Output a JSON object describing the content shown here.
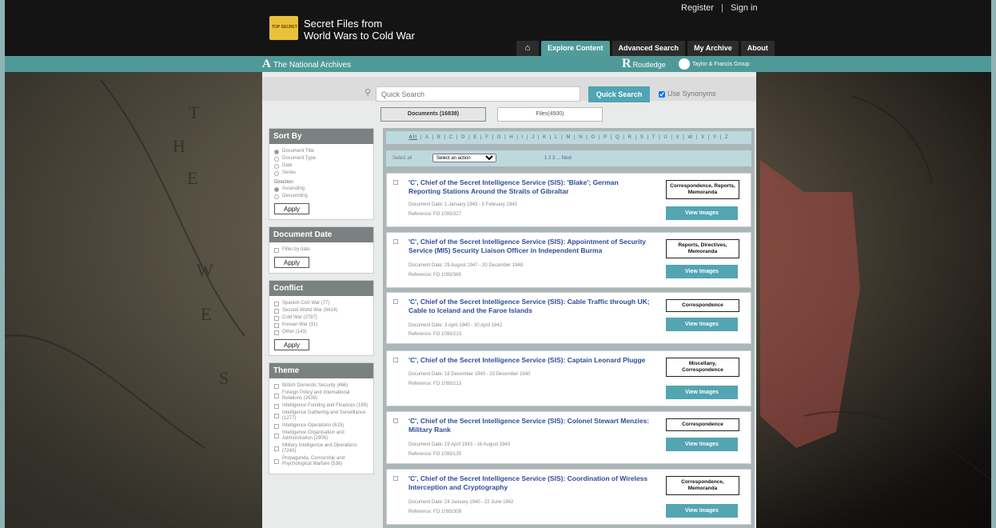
{
  "header": {
    "logo_text": "TOP SECRET",
    "site_title_line1": "Secret Files from",
    "site_title_line2": "World Wars to Cold War",
    "register": "Register",
    "separator": "|",
    "signin": "Sign in",
    "nav": [
      {
        "label": "⌂"
      },
      {
        "label": "Explore Content"
      },
      {
        "label": "Advanced Search"
      },
      {
        "label": "My Archive"
      },
      {
        "label": "About"
      }
    ],
    "tna_logo": "A",
    "tna_label": "The National Archives",
    "routledge_logo": "R",
    "routledge_label": "Routledge",
    "tf_label": "Taylor & Francis Group"
  },
  "search": {
    "placeholder": "Quick Search",
    "button": "Quick Search",
    "synonyms": "Use Synonyms"
  },
  "tabs": {
    "documents": "Documents (16838)",
    "files": "Files(4500)"
  },
  "sidebar": {
    "sort_by": {
      "title": "Sort By",
      "options": [
        "Document Title",
        "Document Type",
        "Date",
        "Series"
      ],
      "direction_label": "Direction",
      "direction": [
        "Ascending",
        "Descending"
      ],
      "apply": "Apply"
    },
    "document_date": {
      "title": "Document Date",
      "filter": "Filter by date",
      "apply": "Apply"
    },
    "conflict": {
      "title": "Conflict",
      "items": [
        "Spanish Civil War (77)",
        "Second World War (8414)",
        "Cold War (2787)",
        "Korean War (31)",
        "Other (143)"
      ],
      "apply": "Apply"
    },
    "theme": {
      "title": "Theme",
      "items": [
        "British Domestic Security (466)",
        "Foreign Policy and International Relations (2638)",
        "Intelligence Funding and Finances (189)",
        "Intelligence Gathering and Surveillance (1277)",
        "Intelligence Operations (615)",
        "Intelligence Organisation and Administration (2905)",
        "Military Intelligence and Operations (7240)",
        "Propaganda, Censorship and Psychological Warfare (536)"
      ]
    }
  },
  "alphabet": [
    "All",
    "A",
    "B",
    "C",
    "D",
    "E",
    "F",
    "G",
    "H",
    "I",
    "J",
    "K",
    "L",
    "M",
    "N",
    "O",
    "P",
    "Q",
    "R",
    "S",
    "T",
    "U",
    "V",
    "W",
    "X",
    "Y",
    "Z"
  ],
  "actionbar": {
    "select_all": "Select all",
    "select_action": "Select an action",
    "pages": "1 2 3 ... Next"
  },
  "results": [
    {
      "title": "'C', Chief of the Secret Intelligence Service (SIS): 'Blake'; German Reporting Stations Around the Straits of Gibraltar",
      "date": "Document Date: 1 January 1943 - 5 February 1943",
      "reference": "Reference: FO 1093/327",
      "type": "Correspondence, Reports, Memoranda",
      "button": "View Images"
    },
    {
      "title": "'C', Chief of the Secret Intelligence Service (SIS): Appointment of Security Service (MI5) Security Liaison Officer in Independent Burma",
      "date": "Document Date: 29 August 1947 - 20 December 1948",
      "reference": "Reference: FO 1093/365",
      "type": "Reports, Directives, Memoranda",
      "button": "View Images"
    },
    {
      "title": "'C', Chief of the Secret Intelligence Service (SIS): Cable Traffic through UK; Cable to Iceland and the Faroe Islands",
      "date": "Document Date: 3 April 1940 - 30 April 1942",
      "reference": "Reference: FO 1093/213",
      "type": "Correspondence",
      "button": "View Images"
    },
    {
      "title": "'C', Chief of the Secret Intelligence Service (SIS): Captain Leonard Plugge",
      "date": "Document Date: 18 December 1940 - 23 December 1940",
      "reference": "Reference: FO 1093/213",
      "type": "Miscellany, Correspondence",
      "button": "View Images"
    },
    {
      "title": "'C', Chief of the Secret Intelligence Service (SIS): Colonel Stewart Menzies: Military Rank",
      "date": "Document Date: 19 April 1943 - 16 August 1943",
      "reference": "Reference: FO 1093/135",
      "type": "Correspondence",
      "button": "View Images"
    },
    {
      "title": "'C', Chief of the Secret Intelligence Service (SIS): Coordination of Wireless Interception and Cryptography",
      "date": "Document Date: 24 January 1940 - 22 June 1942",
      "reference": "Reference: FO 1093/308",
      "type": "Correspondence, Memoranda",
      "button": "View Images"
    }
  ]
}
